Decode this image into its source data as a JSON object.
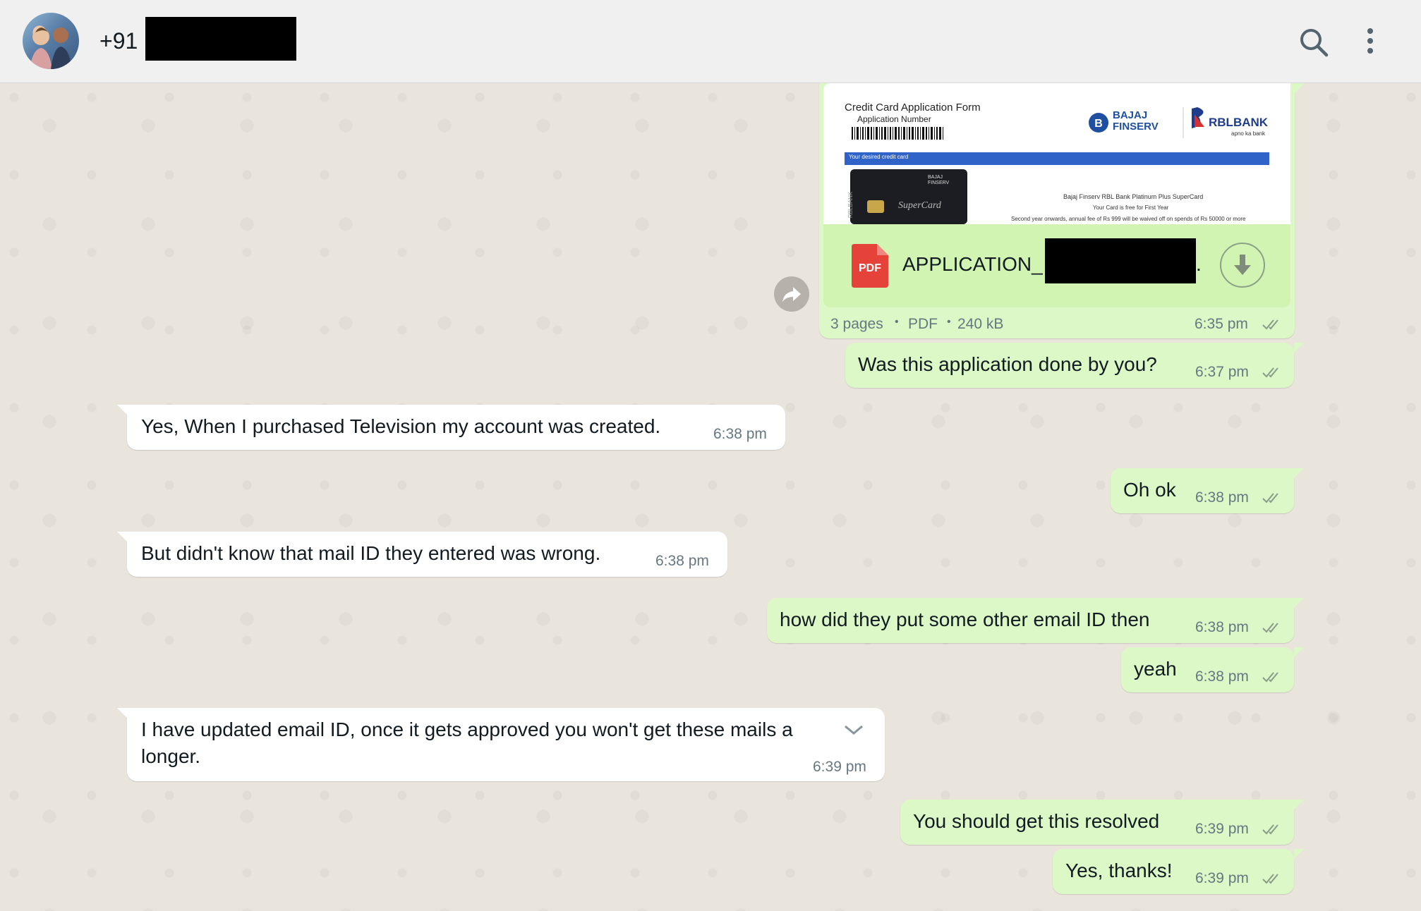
{
  "header": {
    "contact_name": "+91",
    "avatar_icon": "contact-avatar",
    "search_icon": "search-icon",
    "menu_icon": "more-vertical-icon"
  },
  "colors": {
    "header_bg": "#f0f0f0",
    "chat_bg": "#e9e4dc",
    "outgoing_bubble": "#dcf8c6",
    "incoming_bubble": "#ffffff",
    "meta_text": "#667781"
  },
  "document_message": {
    "preview": {
      "title": "Credit Card Application Form",
      "subtitle": "Application Number",
      "brand_left": "BAJAJ FINSERV",
      "brand_right": "RBLBANK",
      "brand_tagline": "apno ka bank",
      "band_text": "Your desired credit card",
      "card_brand": "BAJAJ FINSERV",
      "card_name": "SuperCard",
      "card_side": "RBLBANK",
      "line1": "Bajaj Finserv RBL Bank Platinum Plus SuperCard",
      "line2": "Your Card is free for First Year",
      "line3": "Second year onwards, annual fee of Rs 999 will be waived off on spends of Rs 50000 or more"
    },
    "file_icon_label": "PDF",
    "file_name": "APPLICATION_",
    "file_name_suffix": ".",
    "meta_pages": "3 pages",
    "meta_type": "PDF",
    "meta_size": "240 kB",
    "separator": "•",
    "time": "6:35 pm",
    "download_icon": "download-icon",
    "forward_icon": "forward-icon"
  },
  "messages": [
    {
      "direction": "out",
      "text": "Was this application done by you?",
      "time": "6:37 pm",
      "status": "read"
    },
    {
      "direction": "in",
      "text": "Yes, When I purchased Television my account was created.",
      "time": "6:38 pm"
    },
    {
      "direction": "out",
      "text": "Oh ok",
      "time": "6:38 pm",
      "status": "read"
    },
    {
      "direction": "in",
      "text": "But didn't know that mail ID they entered was wrong.",
      "time": "6:38 pm"
    },
    {
      "direction": "out",
      "text": "how did they put some other email ID then",
      "time": "6:38 pm",
      "status": "read"
    },
    {
      "direction": "out",
      "text": "yeah",
      "time": "6:38 pm",
      "status": "read"
    },
    {
      "direction": "in",
      "text_line1": "I have updated email ID, once it gets approved you won't get these mails a",
      "text_line2": "longer.",
      "time": "6:39 pm",
      "menu_icon": "chevron-down-icon"
    },
    {
      "direction": "out",
      "text": "You should get this resolved",
      "time": "6:39 pm",
      "status": "read"
    },
    {
      "direction": "out",
      "text": "Yes, thanks!",
      "time": "6:39 pm",
      "status": "read"
    }
  ]
}
